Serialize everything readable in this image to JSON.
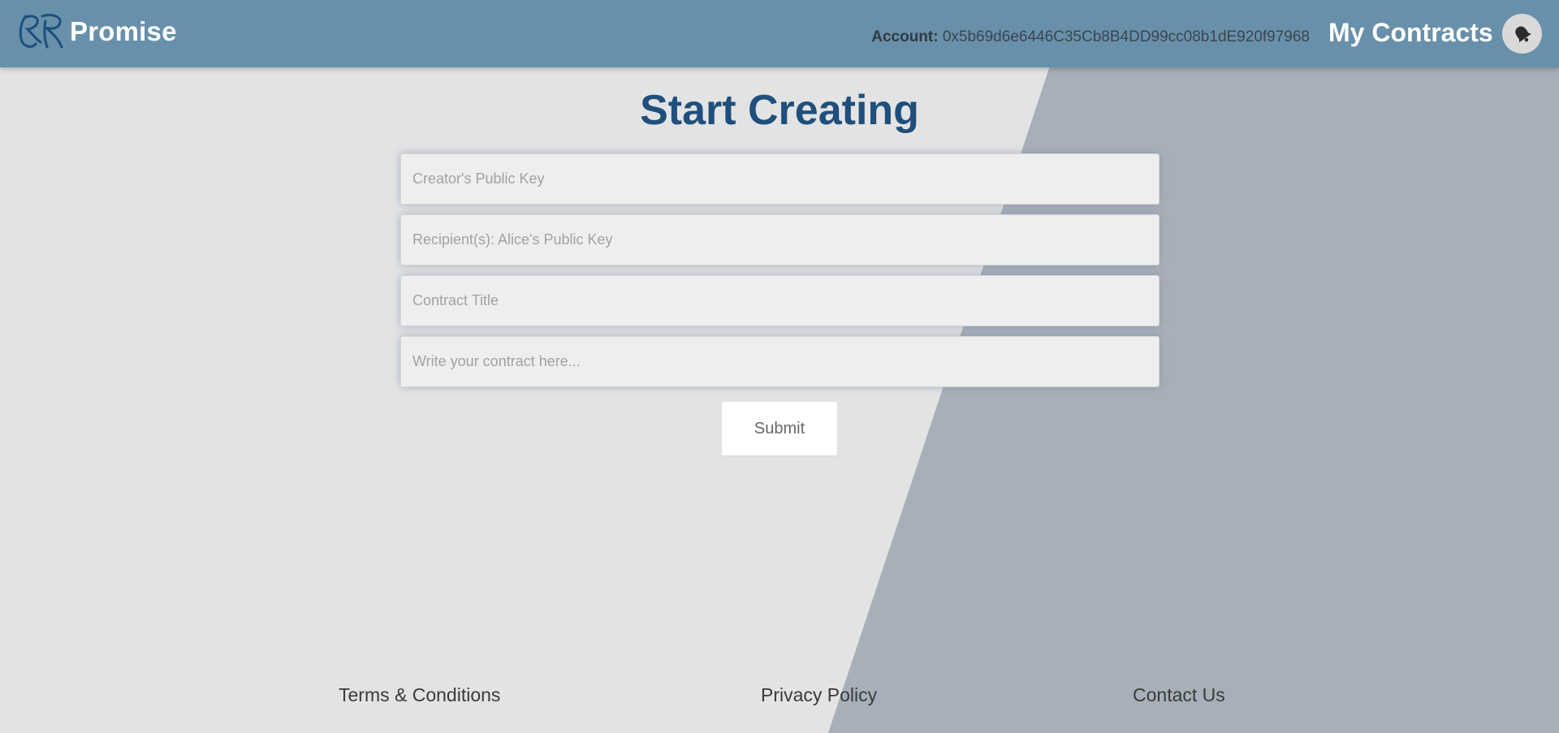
{
  "header": {
    "brand_name": "Promise",
    "account_label": "Account:",
    "account_value": "0x5b69d6e6446C35Cb8B4DD99cc08b1dE920f97968",
    "my_contracts_label": "My Contracts"
  },
  "main": {
    "title": "Start Creating",
    "fields": {
      "creator_placeholder": "Creator's Public Key",
      "recipient_placeholder": "Recipient(s): Alice's Public Key",
      "title_placeholder": "Contract Title",
      "body_placeholder": "Write your contract here..."
    },
    "submit_label": "Submit"
  },
  "footer": {
    "terms": "Terms & Conditions",
    "privacy": "Privacy Policy",
    "contact": "Contact Us"
  },
  "icons": {
    "logo": "promise-logo",
    "avatar": "bell-icon"
  },
  "colors": {
    "header": "#6890aa",
    "title": "#1f4f7c",
    "background_light": "#e3e3e4",
    "background_dark": "#a8afb9"
  }
}
